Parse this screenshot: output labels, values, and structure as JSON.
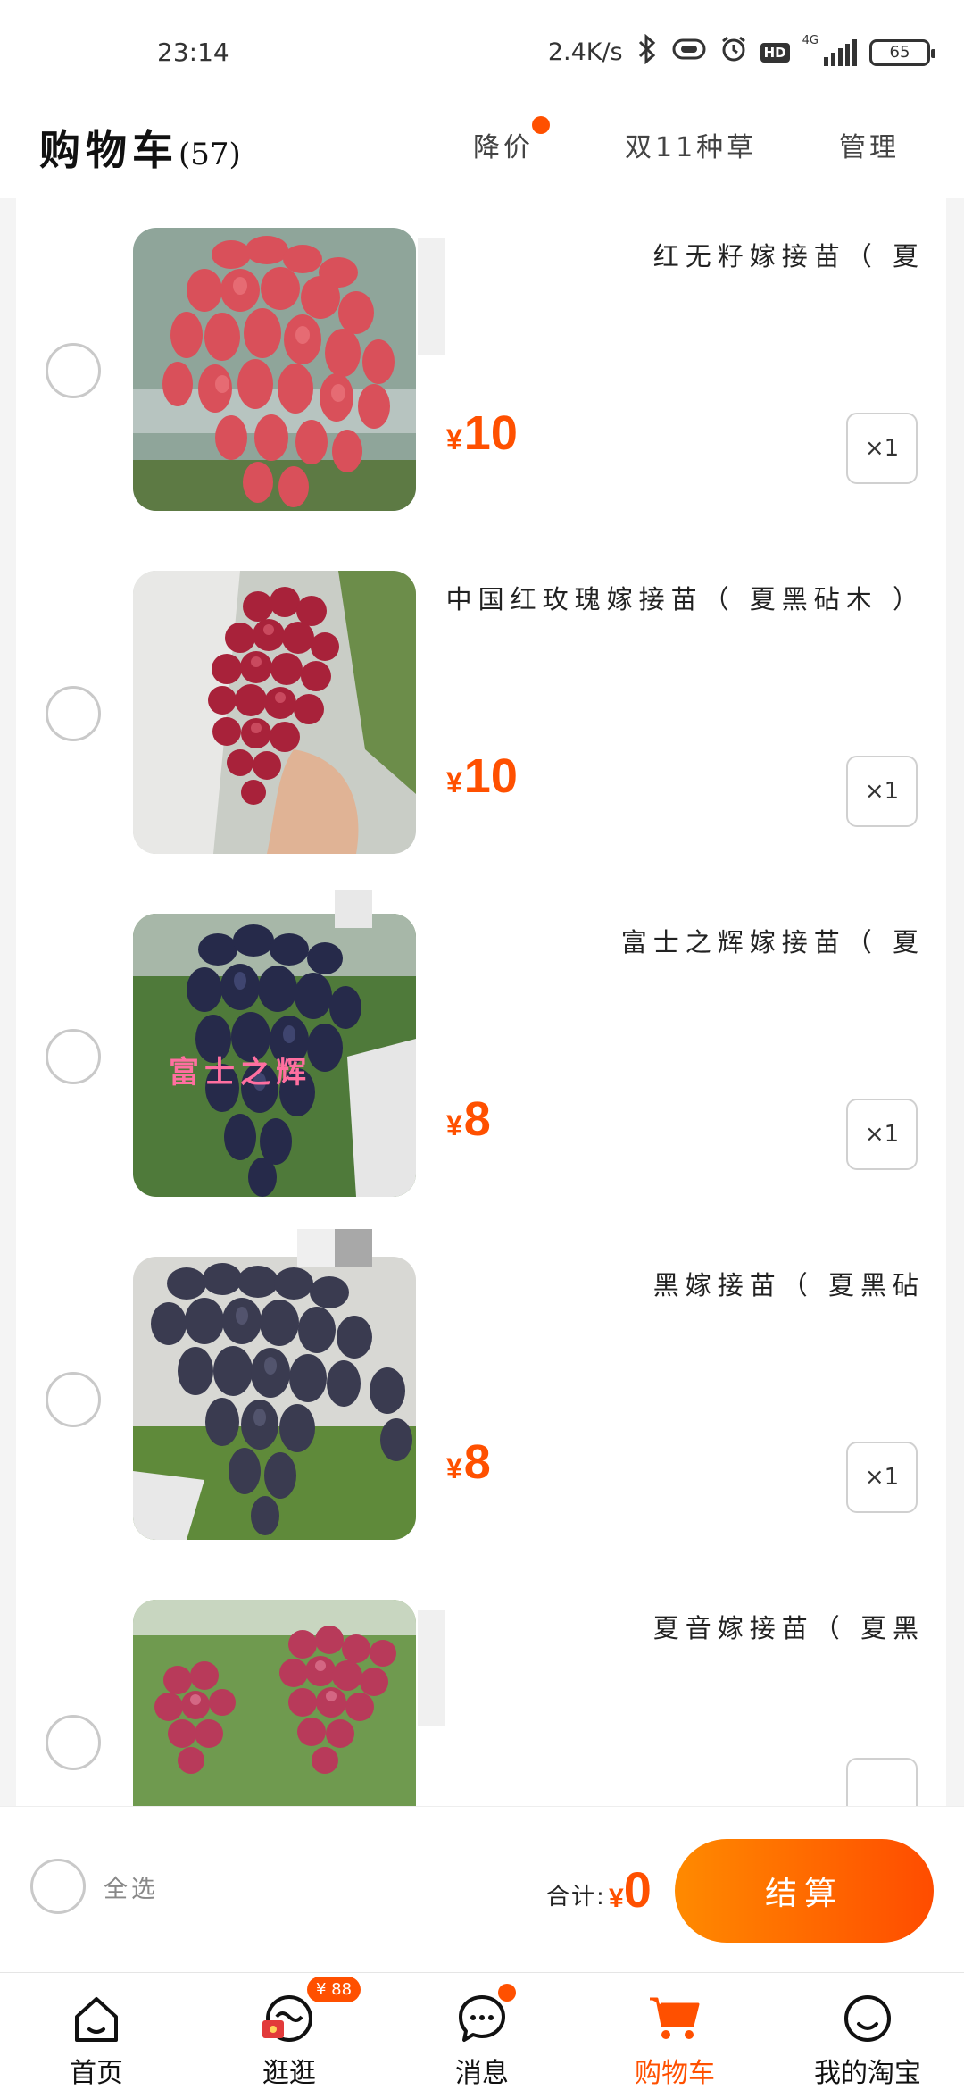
{
  "status_bar": {
    "time": "23:14",
    "net_speed": "2.4K/s",
    "hd": "HD",
    "network": "4G",
    "battery": "65"
  },
  "header": {
    "title": "购物车",
    "count": "(57)",
    "tabs": [
      "降价",
      "双11种草",
      "管理"
    ]
  },
  "items": [
    {
      "title": "红无籽嫁接苗（ 夏",
      "price": "10",
      "qty": "×1"
    },
    {
      "title": "中国红玫瑰嫁接苗（ 夏黑砧木 ）",
      "price": "10",
      "qty": "×1"
    },
    {
      "title": "富士之辉嫁接苗（ 夏",
      "price": "8",
      "qty": "×1",
      "image_text": "富士之辉"
    },
    {
      "title": "黑嫁接苗（ 夏黑砧",
      "price": "8",
      "qty": "×1"
    },
    {
      "title": "夏音嫁接苗（ 夏黑",
      "price": "",
      "qty": ""
    }
  ],
  "currency": "¥",
  "footer": {
    "select_all": "全选",
    "total_label": "合计:",
    "total_value": "0",
    "checkout": "结算"
  },
  "tabbar": {
    "items": [
      {
        "label": "首页",
        "icon": "home-icon"
      },
      {
        "label": "逛逛",
        "icon": "browse-icon",
        "badge": "¥ 88"
      },
      {
        "label": "消息",
        "icon": "message-icon"
      },
      {
        "label": "购物车",
        "icon": "cart-icon"
      },
      {
        "label": "我的淘宝",
        "icon": "profile-icon"
      }
    ]
  },
  "colors": {
    "accent": "#ff5000"
  }
}
